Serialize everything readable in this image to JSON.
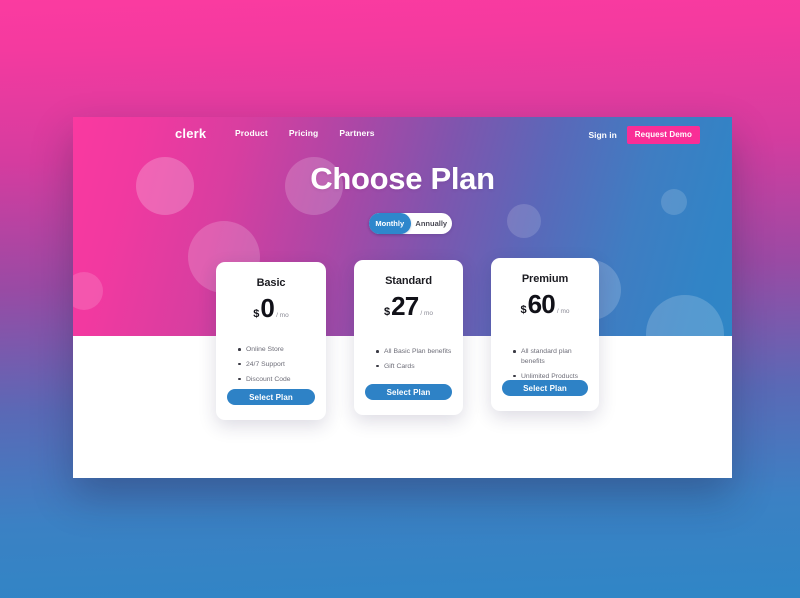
{
  "navbar": {
    "logo": "clerk",
    "links": [
      {
        "label": "Product"
      },
      {
        "label": "Pricing"
      },
      {
        "label": "Partners"
      }
    ],
    "signin_label": "Sign in",
    "demo_label": "Request Demo",
    "demo_color": "#f92e96"
  },
  "hero": {
    "title": "Choose Plan",
    "gradient_start": "#fa39a0",
    "gradient_end": "#2f86c6"
  },
  "billing_toggle": {
    "options": [
      {
        "label": "Monthly",
        "active": true
      },
      {
        "label": "Annually",
        "active": false
      }
    ],
    "active_color": "#2e87cc"
  },
  "plans": [
    {
      "name": "Basic",
      "currency": "$",
      "amount": "0",
      "period": "/ mo",
      "features": [
        "Online Store",
        "24/7 Support",
        "Discount Code"
      ],
      "cta": "Select Plan"
    },
    {
      "name": "Standard",
      "currency": "$",
      "amount": "27",
      "period": "/ mo",
      "features": [
        "All Basic Plan benefits",
        "Gift Cards"
      ],
      "cta": "Select Plan"
    },
    {
      "name": "Premium",
      "currency": "$",
      "amount": "60",
      "period": "/ mo",
      "features": [
        "All standard plan benefits",
        "Unlimited Products"
      ],
      "cta": "Select Plan"
    }
  ],
  "theme": {
    "cta_color": "#2e82c6",
    "page_bg_top": "#fb3ba0",
    "page_bg_bottom": "#2f86c6"
  }
}
